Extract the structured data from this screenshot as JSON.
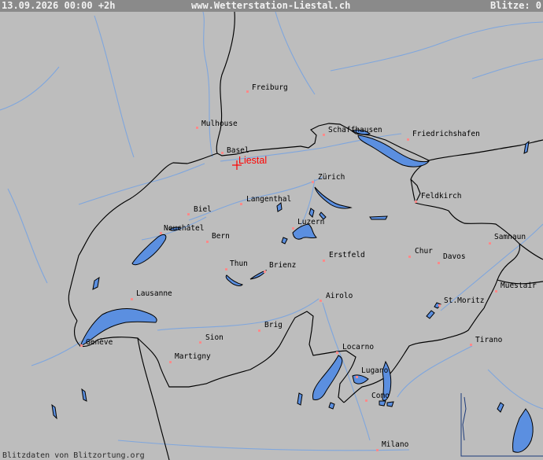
{
  "header": {
    "datetime": "13.09.2026 00:00 +2h",
    "site": "www.Wetterstation-Liestal.ch",
    "strikes": "Blitze: 0"
  },
  "station": {
    "name": "Liestal"
  },
  "cities": [
    {
      "id": "freiburg",
      "name": "Freiburg"
    },
    {
      "id": "mulhouse",
      "name": "Mulhouse"
    },
    {
      "id": "basel",
      "name": "Basel"
    },
    {
      "id": "schaffhausen",
      "name": "Schaffhausen"
    },
    {
      "id": "friedrichshafen",
      "name": "Friedrichshafen"
    },
    {
      "id": "zurich",
      "name": "Zürich"
    },
    {
      "id": "langenthal",
      "name": "Langenthal"
    },
    {
      "id": "feldkirch",
      "name": "Feldkirch"
    },
    {
      "id": "biel",
      "name": "Biel"
    },
    {
      "id": "luzern",
      "name": "Luzern"
    },
    {
      "id": "neuchatel",
      "name": "Neuchâtel"
    },
    {
      "id": "bern",
      "name": "Bern"
    },
    {
      "id": "samnaun",
      "name": "Samnaun"
    },
    {
      "id": "chur",
      "name": "Chur"
    },
    {
      "id": "erstfeld",
      "name": "Erstfeld"
    },
    {
      "id": "davos",
      "name": "Davos"
    },
    {
      "id": "thun",
      "name": "Thun"
    },
    {
      "id": "brienz",
      "name": "Brienz"
    },
    {
      "id": "muestair",
      "name": "Muestair"
    },
    {
      "id": "lausanne",
      "name": "Lausanne"
    },
    {
      "id": "airolo",
      "name": "Airolo"
    },
    {
      "id": "stmoritz",
      "name": "St.Moritz"
    },
    {
      "id": "brig",
      "name": "Brig"
    },
    {
      "id": "geneve",
      "name": "Genève"
    },
    {
      "id": "sion",
      "name": "Sion"
    },
    {
      "id": "tirano",
      "name": "Tirano"
    },
    {
      "id": "locarno",
      "name": "Locarno"
    },
    {
      "id": "martigny",
      "name": "Martigny"
    },
    {
      "id": "lugano",
      "name": "Lugano"
    },
    {
      "id": "como",
      "name": "Como"
    },
    {
      "id": "milano",
      "name": "Milano"
    }
  ],
  "footer": {
    "credit": "Blitzdaten von Blitzortung.org"
  },
  "colors": {
    "background": "#bdbdbd",
    "water": "#5b8fe0",
    "river": "#7fa6dd",
    "border": "#000000",
    "station": "#ff0000",
    "city_marker": "#ff8a8a"
  }
}
